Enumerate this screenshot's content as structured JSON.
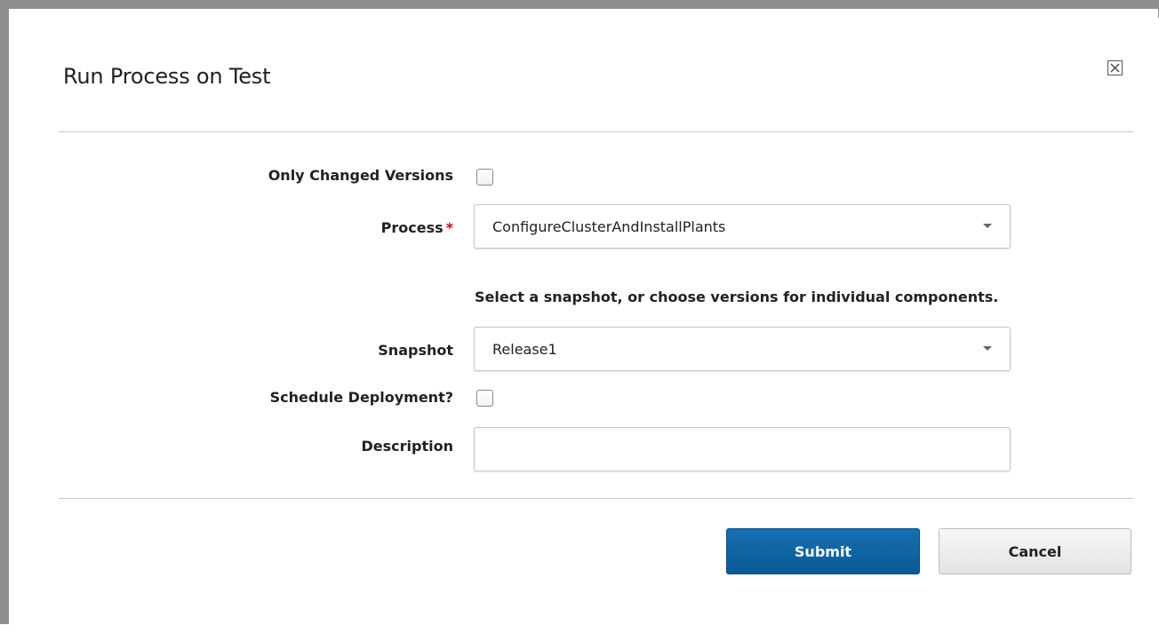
{
  "dialog": {
    "title": "Run Process on Test",
    "close_icon": "close-x-icon"
  },
  "form": {
    "only_changed_versions": {
      "label": "Only Changed Versions",
      "checked": false
    },
    "process": {
      "label": "Process",
      "required_marker": "*",
      "value": "ConfigureClusterAndInstallPlants"
    },
    "hint": "Select a snapshot, or choose versions for individual components.",
    "snapshot": {
      "label": "Snapshot",
      "value": "Release1"
    },
    "schedule_deployment": {
      "label": "Schedule Deployment?",
      "checked": false
    },
    "description": {
      "label": "Description",
      "value": ""
    }
  },
  "buttons": {
    "submit": "Submit",
    "cancel": "Cancel"
  },
  "colors": {
    "primary": "#0f68a8",
    "required": "#d0021b",
    "frame": "#8e8e8e"
  }
}
